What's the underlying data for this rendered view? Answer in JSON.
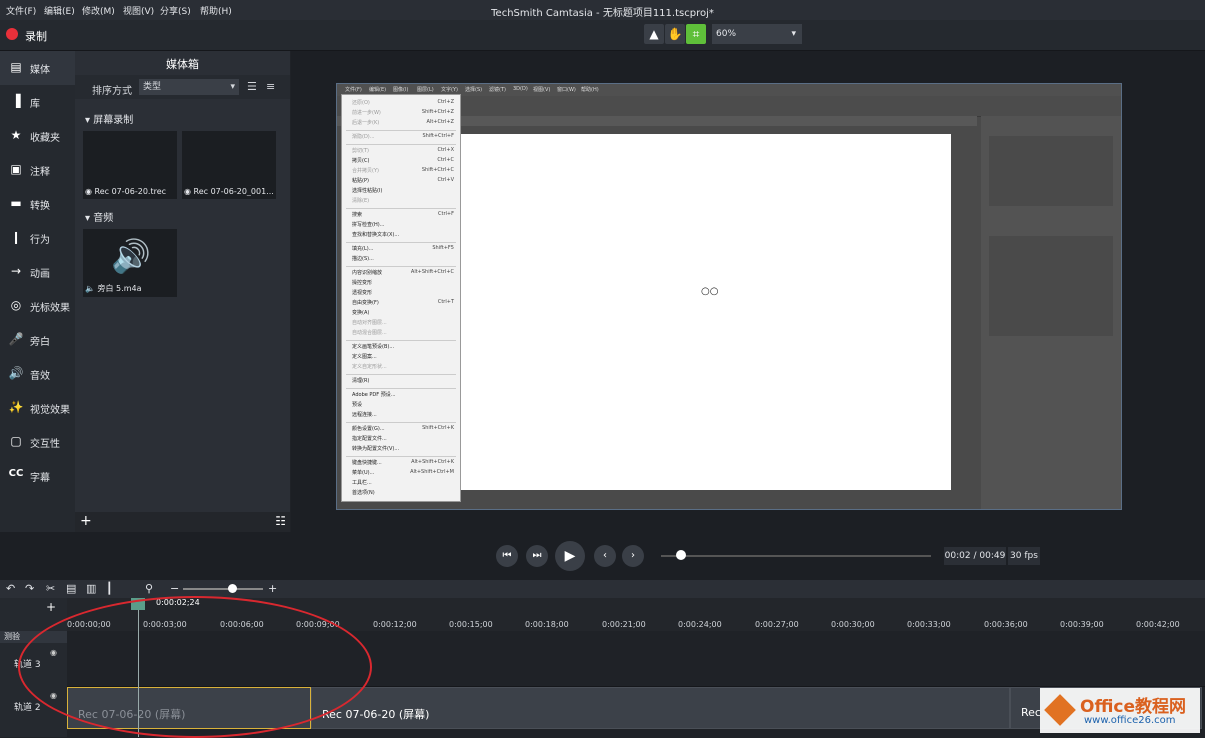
{
  "menubar": {
    "items": [
      "文件(F)",
      "编辑(E)",
      "修改(M)",
      "视图(V)",
      "分享(S)",
      "帮助(H)"
    ],
    "title": "TechSmith Camtasia - 无标题项目111.tscproj*"
  },
  "toolbar": {
    "record_label": "录制",
    "zoom_value": "60%"
  },
  "leftnav": {
    "items": [
      {
        "icon": "media-icon",
        "label": "媒体"
      },
      {
        "icon": "library-icon",
        "label": "库"
      },
      {
        "icon": "favorites-icon",
        "label": "收藏夹"
      },
      {
        "icon": "annotation-icon",
        "label": "注释"
      },
      {
        "icon": "transition-icon",
        "label": "转换"
      },
      {
        "icon": "behavior-icon",
        "label": "行为"
      },
      {
        "icon": "animation-icon",
        "label": "动画"
      },
      {
        "icon": "cursor-effect-icon",
        "label": "光标效果"
      },
      {
        "icon": "microphone-icon",
        "label": "旁白"
      },
      {
        "icon": "audio-effect-icon",
        "label": "音效"
      },
      {
        "icon": "visual-effect-icon",
        "label": "视觉效果"
      },
      {
        "icon": "interactivity-icon",
        "label": "交互性"
      },
      {
        "icon": "captions-icon",
        "label": "字幕"
      }
    ]
  },
  "mediabin": {
    "title": "媒体箱",
    "sort_label": "排序方式",
    "sort_value": "类型",
    "section_screen": "屏幕录制",
    "section_audio": "音频",
    "clips": [
      "Rec 07-06-20.trec",
      "Rec 07-06-20_001..."
    ],
    "audio_clip": "旁白 5.m4a"
  },
  "photoshop": {
    "menus": [
      "文件(F)",
      "编辑(E)",
      "图像(I)",
      "图层(L)",
      "文字(Y)",
      "选择(S)",
      "滤镜(T)",
      "3D(D)",
      "视图(V)",
      "窗口(W)",
      "帮助(H)"
    ],
    "edit_menu": [
      {
        "label": "还原(O)",
        "key": "Ctrl+Z",
        "disabled": true
      },
      {
        "label": "前进一步(W)",
        "key": "Shift+Ctrl+Z",
        "disabled": true
      },
      {
        "label": "后退一步(K)",
        "key": "Alt+Ctrl+Z",
        "disabled": true
      },
      {
        "label": "渐隐(D)...",
        "key": "Shift+Ctrl+F",
        "disabled": true
      },
      {
        "label": "剪切(T)",
        "key": "Ctrl+X",
        "disabled": true
      },
      {
        "label": "拷贝(C)",
        "key": "Ctrl+C",
        "disabled": false
      },
      {
        "label": "合并拷贝(Y)",
        "key": "Shift+Ctrl+C",
        "disabled": true
      },
      {
        "label": "粘贴(P)",
        "key": "Ctrl+V",
        "disabled": false
      },
      {
        "label": "选择性粘贴(I)",
        "key": "",
        "disabled": false
      },
      {
        "label": "清除(E)",
        "key": "",
        "disabled": true
      },
      {
        "label": "搜索",
        "key": "Ctrl+F",
        "disabled": false
      },
      {
        "label": "拼写检查(H)...",
        "key": "",
        "disabled": false
      },
      {
        "label": "查找和替换文本(X)...",
        "key": "",
        "disabled": false
      },
      {
        "label": "填充(L)...",
        "key": "Shift+F5",
        "disabled": false
      },
      {
        "label": "描边(S)...",
        "key": "",
        "disabled": false
      },
      {
        "label": "内容识别缩放",
        "key": "Alt+Shift+Ctrl+C",
        "disabled": false
      },
      {
        "label": "操控变形",
        "key": "",
        "disabled": false
      },
      {
        "label": "透视变形",
        "key": "",
        "disabled": false
      },
      {
        "label": "自由变换(F)",
        "key": "Ctrl+T",
        "disabled": false
      },
      {
        "label": "变换(A)",
        "key": "",
        "disabled": false
      },
      {
        "label": "自动对齐图层...",
        "key": "",
        "disabled": true
      },
      {
        "label": "自动混合图层...",
        "key": "",
        "disabled": true
      },
      {
        "label": "定义画笔预设(B)...",
        "key": "",
        "disabled": false
      },
      {
        "label": "定义图案...",
        "key": "",
        "disabled": false
      },
      {
        "label": "定义自定形状...",
        "key": "",
        "disabled": true
      },
      {
        "label": "清理(R)",
        "key": "",
        "disabled": false
      },
      {
        "label": "Adobe PDF 预设...",
        "key": "",
        "disabled": false
      },
      {
        "label": "预设",
        "key": "",
        "disabled": false
      },
      {
        "label": "远程连接...",
        "key": "",
        "disabled": false
      },
      {
        "label": "颜色设置(G)...",
        "key": "Shift+Ctrl+K",
        "disabled": false
      },
      {
        "label": "指定配置文件...",
        "key": "",
        "disabled": false
      },
      {
        "label": "转换为配置文件(V)...",
        "key": "",
        "disabled": false
      },
      {
        "label": "键盘快捷键...",
        "key": "Alt+Shift+Ctrl+K",
        "disabled": false
      },
      {
        "label": "菜单(U)...",
        "key": "Alt+Shift+Ctrl+M",
        "disabled": false
      },
      {
        "label": "工具栏...",
        "key": "",
        "disabled": false
      },
      {
        "label": "首选项(N)",
        "key": "",
        "disabled": false
      }
    ]
  },
  "playback": {
    "time": "00:02 / 00:49",
    "fps": "30 fps"
  },
  "timeline": {
    "playhead_time": "0:00:02;24",
    "ticks": [
      "0:00:00;00",
      "0:00:03;00",
      "0:00:06;00",
      "0:00:09;00",
      "0:00:12;00",
      "0:00:15;00",
      "0:00:18;00",
      "0:00:21;00",
      "0:00:24;00",
      "0:00:27;00",
      "0:00:30;00",
      "0:00:33;00",
      "0:00:36;00",
      "0:00:39;00",
      "0:00:42;00"
    ],
    "test_label": "测验",
    "track3": "轨道 3",
    "track2": "轨道 2",
    "clip1": "Rec 07-06-20 (屏幕)",
    "clip2": "Rec 07-06-20 (屏幕)",
    "clip3": "Rec"
  },
  "watermark": {
    "name": "Office教程网",
    "url": "www.office26.com"
  },
  "colors": {
    "record": "#e8303a",
    "accent_green": "#5fbf3a",
    "annotation": "#d9282f"
  }
}
